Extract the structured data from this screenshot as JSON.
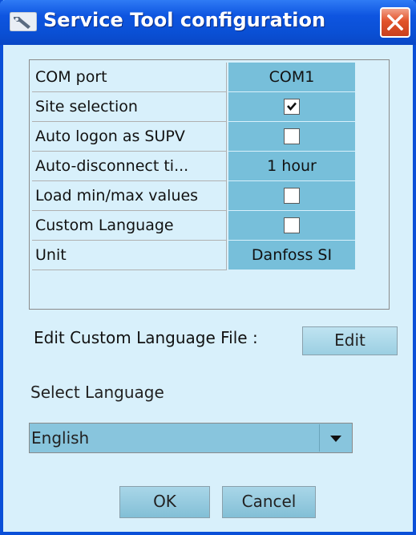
{
  "window": {
    "title": "Service Tool configuration",
    "title_icon": "wrench-icon",
    "close_icon": "close-icon"
  },
  "properties": [
    {
      "label": "COM port",
      "type": "text",
      "value": "COM1"
    },
    {
      "label": "Site selection",
      "type": "checkbox",
      "checked": true
    },
    {
      "label": "Auto logon as SUPV",
      "type": "checkbox",
      "checked": false
    },
    {
      "label": "Auto-disconnect ti...",
      "type": "text",
      "value": "1 hour"
    },
    {
      "label": "Load min/max values",
      "type": "checkbox",
      "checked": false
    },
    {
      "label": "Custom Language",
      "type": "checkbox",
      "checked": false
    },
    {
      "label": "Unit",
      "type": "text",
      "value": "Danfoss SI"
    }
  ],
  "edit_custom_language": {
    "label": "Edit Custom Language File :",
    "button": "Edit"
  },
  "language": {
    "label": "Select Language",
    "selected": "English",
    "arrow_icon": "chevron-down-icon"
  },
  "buttons": {
    "ok": "OK",
    "cancel": "Cancel"
  },
  "colors": {
    "titlebar": "#0a4fd4",
    "background": "#d8f0fb",
    "value_cell": "#77bfda",
    "close_button": "#e2532a"
  }
}
